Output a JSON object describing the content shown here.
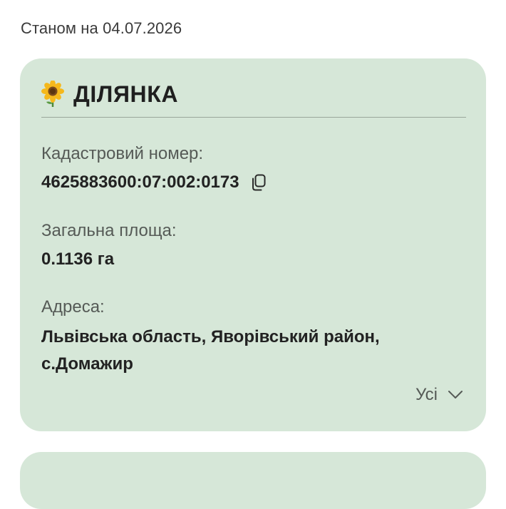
{
  "status_date": "Станом на 04.07.2026",
  "parcel_card": {
    "icon": "sunflower-icon",
    "title": "ДІЛЯНКА",
    "cadastral_label": "Кадастровий номер:",
    "cadastral_value": "4625883600:07:002:0173",
    "area_label": "Загальна площа:",
    "area_value": "0.1136 га",
    "address_label": "Адреса:",
    "address_value": "Львівська область, Яворівський район, с.Домажир",
    "all_label": "Усі"
  },
  "colors": {
    "card_background": "#d6e7d8",
    "label_text": "#555a56",
    "value_text": "#222222"
  }
}
